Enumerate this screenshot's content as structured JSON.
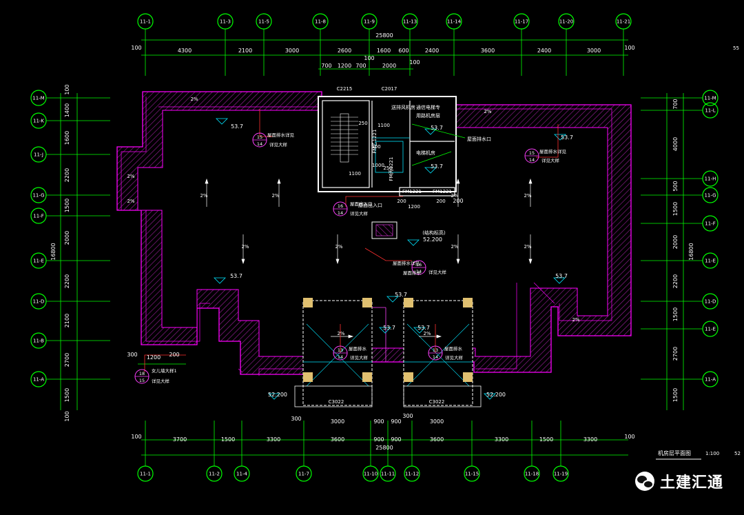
{
  "axes_top": [
    "11-1",
    "11-3",
    "11-5",
    "11-8",
    "11-9",
    "11-13",
    "11-14",
    "11-17",
    "11-20",
    "11-21"
  ],
  "axes_bottom": [
    "11-1",
    "11-2",
    "11-4",
    "11-7",
    "11-10",
    "11-11",
    "11-12",
    "11-15",
    "11-18",
    "11-19"
  ],
  "axes_left": [
    "11-M",
    "11-K",
    "11-J",
    "11-G",
    "11-F",
    "11-E",
    "11-D",
    "11-B",
    "11-A"
  ],
  "axes_right": [
    "11-M",
    "11-L",
    "11-H",
    "11-G",
    "11-F",
    "11-E",
    "11-D",
    "11-E",
    "11-A"
  ],
  "dims": {
    "top_total": "25800",
    "top_segments": [
      "4300",
      "2100",
      "3000",
      "2600",
      "1600",
      "600",
      "2400",
      "3600",
      "2400",
      "3000"
    ],
    "top_edge_left": "100",
    "top_edge_right": "100",
    "top_small": [
      "100",
      "700",
      "1200",
      "700",
      "2000",
      "100"
    ],
    "top_side": "200",
    "bottom_total": "25800",
    "bottom_segments": [
      "3700",
      "1500",
      "3300",
      "3600",
      "900",
      "900",
      "3600",
      "3300",
      "1500",
      "3300"
    ],
    "bottom_edge_left": "100",
    "bottom_edge_right": "100",
    "bottom_small": [
      "300",
      "3000",
      "900",
      "900",
      "3000",
      "300"
    ],
    "left_total": "16800",
    "left_segments": [
      "100",
      "1400",
      "1600",
      "2200",
      "1500",
      "2000",
      "2200",
      "2100",
      "2700",
      "1500",
      "100"
    ],
    "right_total": "16800",
    "right_segments": [
      "700",
      "4000",
      "500",
      "1500",
      "2000",
      "2200",
      "1500",
      "2700",
      "1500"
    ],
    "left_small": [
      "300",
      "1200",
      "200"
    ],
    "stair_dims": [
      "250",
      "1100",
      "300",
      "1000",
      "1100",
      "250",
      "1200",
      "200",
      "200"
    ]
  },
  "elevations": {
    "e1": "53.7",
    "e2": "53.7",
    "e3": "53.7",
    "e4": "53.7",
    "e5": "53.7",
    "e6": "53.7",
    "e7": "53.7",
    "e8": "53.7",
    "e9": "53.7",
    "e10": "52.200",
    "e11": "52.200",
    "e12": "52.200"
  },
  "slopes": [
    "2%",
    "2%",
    "2%",
    "2%",
    "2%",
    "2%",
    "2%",
    "2%",
    "2%",
    "2%",
    "2%",
    "2%",
    "2%",
    "2%",
    "2%"
  ],
  "room_labels": {
    "room1": "通信电梯专",
    "room1b": "用路机房层",
    "room2": "电梯机房",
    "room3": "送排风机房",
    "room4": "屋面排水口",
    "stair_top": "C2215",
    "stair_top2": "C2017",
    "window1": "FM1221",
    "window2": "FM1221",
    "window3": "C3022",
    "window4": "C3022",
    "door1": "FM乙1221",
    "door2": "FM丙1221",
    "mech": "(结构标高)",
    "roof": "屋面出入口"
  },
  "bubbles": [
    {
      "top": "15",
      "bottom": "14",
      "note": "详见大样"
    },
    {
      "top": "15",
      "bottom": "14",
      "note": "详见大样"
    },
    {
      "top": "16",
      "bottom": "14",
      "note": "详见大样"
    },
    {
      "top": "16",
      "bottom": "14",
      "note": "详见大样"
    },
    {
      "top": "13",
      "bottom": "14",
      "note": "详见大样"
    },
    {
      "top": "13",
      "bottom": "14",
      "note": "详见大样"
    },
    {
      "top": "18",
      "bottom": "15",
      "note": "详见大样"
    }
  ],
  "bubble_notes": {
    "n1": "屋面排水详见",
    "n2": "屋面排水详见",
    "n3": "屋面排水详见",
    "n4": "屋面排水",
    "n5": "屋面排水",
    "n6": "女儿墙大样1",
    "n7": "屋面出入口",
    "n8": "屋面排水"
  },
  "drawing_title": "机房层平面图",
  "drawing_scale": "1:100",
  "cutoff_right_top": "55",
  "cutoff_right_bottom": "52",
  "watermark": "土建汇通",
  "colors": {
    "axis": "#00ff00",
    "dim": "#00ff00",
    "wall": "#ffffff",
    "parapet": "#ff00ff",
    "hatch": "#a020a0",
    "cyan": "#00e5ff",
    "red": "#ff3030",
    "magenta": "#ff40ff",
    "text": "#ffffff",
    "bg": "#000000"
  }
}
